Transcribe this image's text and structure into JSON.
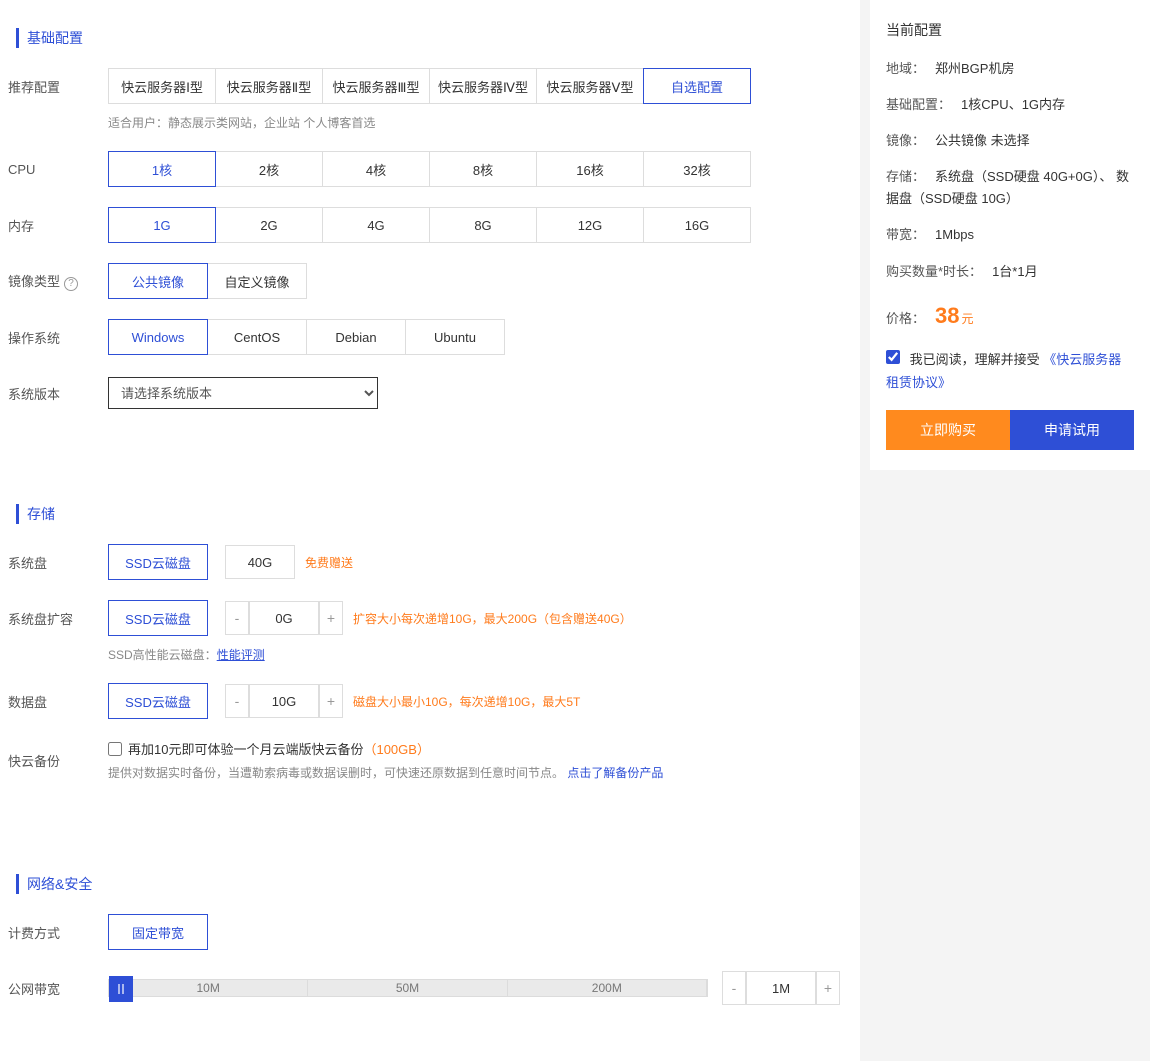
{
  "sections": {
    "basic": "基础配置",
    "storage": "存储",
    "network": "网络&安全"
  },
  "labels": {
    "recommend": "推荐配置",
    "cpu": "CPU",
    "memory": "内存",
    "imageType": "镜像类型",
    "os": "操作系统",
    "sysVersion": "系统版本",
    "sysDisk": "系统盘",
    "sysDiskExt": "系统盘扩容",
    "dataDisk": "数据盘",
    "backup": "快云备份",
    "billing": "计费方式",
    "bandwidth": "公网带宽"
  },
  "recommend": {
    "options": [
      "快云服务器Ⅰ型",
      "快云服务器Ⅱ型",
      "快云服务器Ⅲ型",
      "快云服务器Ⅳ型",
      "快云服务器Ⅴ型",
      "自选配置"
    ],
    "selected": 5,
    "hint": "适合用户：静态展示类网站，企业站 个人博客首选"
  },
  "cpu": {
    "options": [
      "1核",
      "2核",
      "4核",
      "8核",
      "16核",
      "32核"
    ],
    "selected": 0
  },
  "memory": {
    "options": [
      "1G",
      "2G",
      "4G",
      "8G",
      "12G",
      "16G"
    ],
    "selected": 0
  },
  "imageType": {
    "options": [
      "公共镜像",
      "自定义镜像"
    ],
    "selected": 0,
    "help": "?"
  },
  "os": {
    "options": [
      "Windows",
      "CentOS",
      "Debian",
      "Ubuntu"
    ],
    "selected": 0
  },
  "sysVersion": {
    "placeholder": "请选择系统版本"
  },
  "sysDisk": {
    "type": "SSD云磁盘",
    "size": "40G",
    "gift": "免费赠送"
  },
  "sysDiskExt": {
    "type": "SSD云磁盘",
    "size": "0G",
    "note": "扩容大小每次递增10G，最大200G（包含赠送40G）",
    "perfLabel": "SSD高性能云磁盘：",
    "perfLink": "性能评测"
  },
  "dataDisk": {
    "type": "SSD云磁盘",
    "size": "10G",
    "note": "磁盘大小最小10G，每次递增10G，最大5T"
  },
  "backup": {
    "cbLabel": "再加10元即可体验一个月云端版快云备份",
    "cbExtra": "（100GB）",
    "hint": "提供对数据实时备份，当遭勒索病毒或数据误删时，可快速还原数据到任意时间节点。",
    "link": "点击了解备份产品"
  },
  "billing": {
    "options": [
      "固定带宽"
    ],
    "selected": 0
  },
  "bandwidth": {
    "marks": [
      "10M",
      "50M",
      "200M"
    ],
    "value": "1M"
  },
  "summary": {
    "title": "当前配置",
    "region": {
      "label": "地域：",
      "value": "郑州BGP机房"
    },
    "basic": {
      "label": "基础配置：",
      "value": "1核CPU、1G内存"
    },
    "image": {
      "label": "镜像：",
      "value": "公共镜像 未选择"
    },
    "storage": {
      "label": "存储：",
      "value": "系统盘（SSD硬盘 40G+0G）、 数据盘（SSD硬盘 10G）"
    },
    "bandwidth": {
      "label": "带宽：",
      "value": "1Mbps"
    },
    "qty": {
      "label": "购买数量*时长：",
      "value": "1台*1月"
    },
    "price": {
      "label": "价格：",
      "value": "38",
      "unit": "元"
    },
    "agree": {
      "prefix": "我已阅读，理解并接受",
      "link": "《快云服务器租赁协议》"
    },
    "buy": "立即购买",
    "trial": "申请试用"
  }
}
